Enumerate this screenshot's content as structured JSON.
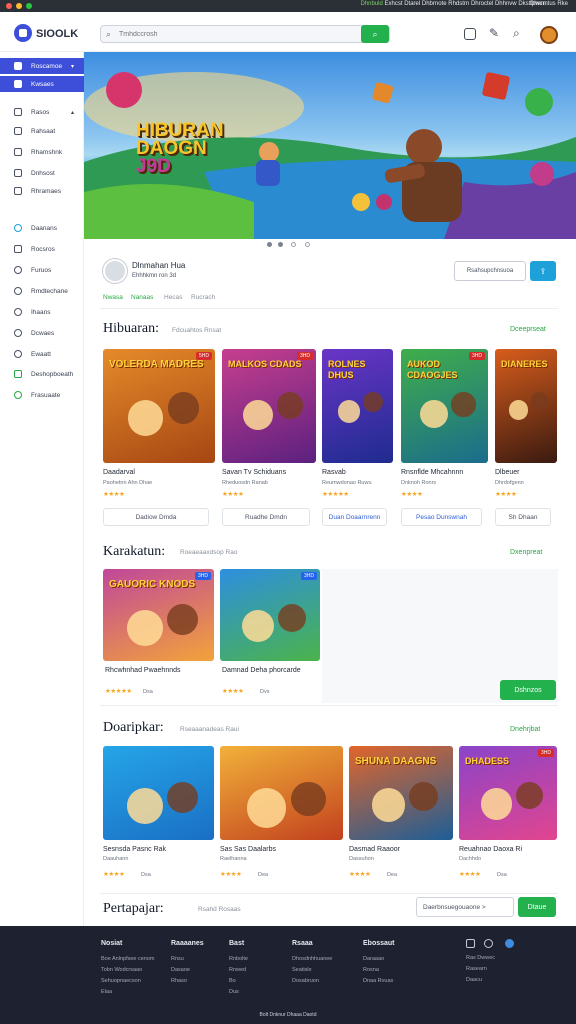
{
  "os": {
    "links": [
      "Dhnbuld",
      "Exhcst",
      "Dtarel",
      "Dhbrnote",
      "Rhdstrn",
      "Dhroctel",
      "Dhhnvw",
      "Dkstfpwcn"
    ],
    "user": "Dhenntus Rke"
  },
  "header": {
    "brand": "SIOOLK",
    "search_placeholder": "Tmhdccrosh",
    "search_button_icon": "search-icon",
    "icons": [
      "cast-icon",
      "edit-icon",
      "search-icon",
      "avatar"
    ]
  },
  "sidebar": {
    "items": [
      {
        "label": "Roscamoe",
        "active": true,
        "chevron": true
      },
      {
        "label": "Kwsaes",
        "active": true
      },
      {
        "label": "Rasos",
        "chevron": true
      },
      {
        "label": "Rahsaat"
      },
      {
        "label": "Rhamshnk"
      },
      {
        "label": "Dnhsost"
      },
      {
        "label": "Rhramaes"
      },
      {
        "label": "Daanans"
      },
      {
        "label": "Rocsros"
      },
      {
        "label": "Furuos"
      },
      {
        "label": "Rmdtechane"
      },
      {
        "label": "Ihaans"
      },
      {
        "label": "Dcwaes"
      },
      {
        "label": "Ewaatt"
      },
      {
        "label": "Deshopboeath"
      },
      {
        "label": "Frasuaate"
      }
    ]
  },
  "banner": {
    "title_line1": "HIBURAN",
    "title_line2": "DAOGN",
    "title_line3": "J9D",
    "page_dots": 4,
    "active_dot": 1
  },
  "channel": {
    "name": "Dlnmahan Hua",
    "sub": "Ehhhkmn ron 3d",
    "tabs": [
      "Nwasa",
      "Nanaas",
      "Hecas",
      "Rucrach"
    ],
    "active_tab": 0,
    "subscribe_label": "Rsahsupchnsuoa",
    "share_icon": "share-icon"
  },
  "sections": {
    "hiburan": {
      "title": "Hibuaran:",
      "subtitle": "Fdcuahtos Rnsat",
      "see_all": "Dceeprseat",
      "cards": [
        {
          "title": "Daadarval",
          "meta": "Paohetnn Ahn Dhae",
          "stars": "★★★★",
          "btn": "Dadiow Dmda",
          "badge": "5HD",
          "thumb_title": "VOLERDA MADRES",
          "colors": [
            "#e58b2a",
            "#a64613"
          ]
        },
        {
          "title": "Savan Tv Schiduans",
          "meta": "Rheduosdn Ranab",
          "stars": "★★★★",
          "btn": "Ruadhe Dmdn",
          "badge": "3HD",
          "thumb_title": "MALKOS CDADS",
          "colors": [
            "#c63f8e",
            "#5c2080"
          ]
        },
        {
          "title": "Rasvab",
          "meta": "Reumwdonao Ruwu",
          "stars": "★★★★★",
          "btn": "Duan Doaarnrenn",
          "badge": "",
          "thumb_title": "ROLNES DHUS",
          "colors": [
            "#6a35c7",
            "#1e2b8f"
          ]
        },
        {
          "title": "Rnsnflde Mhcahnnn",
          "meta": "Dnknoh Ronrs",
          "stars": "★★★★",
          "btn": "Pesao Dunswnah",
          "badge": "3HD",
          "thumb_title": "AUKOD CDAOGJES",
          "colors": [
            "#3fae4a",
            "#1b6c8c"
          ]
        },
        {
          "title": "Dlbeuer",
          "meta": "Dhrdofgenn",
          "stars": "★★★★",
          "btn": "Sh Dhaan",
          "badge": "",
          "thumb_title": "DIANERES",
          "colors": [
            "#d75d1c",
            "#3a1a10"
          ]
        }
      ]
    },
    "karakatun": {
      "title": "Karakatun:",
      "subtitle": "Roeaeaaxdsop Rao",
      "see_all": "Dxenpreat",
      "cards": [
        {
          "title": "Rhcwhnhad Pwaehnnds",
          "stars": "★★★★★",
          "rating": "Dsa",
          "badge": "3HD",
          "thumb_title": "GAUORIC KNODS",
          "colors": [
            "#c0479a",
            "#f2a33a"
          ]
        },
        {
          "title": "Damnad Deha phorcarde",
          "stars": "★★★★",
          "rating": "Dvs",
          "badge": "3HD",
          "thumb_title": "",
          "colors": [
            "#2d8fe0",
            "#4bb34a"
          ]
        }
      ],
      "action_label": "Dshnzos"
    },
    "doarikpkar": {
      "title": "Doaripkar:",
      "subtitle": "Rseaaanadeas Raui",
      "see_all": "Dnehrjbat",
      "cards": [
        {
          "title": "Sesnsda Pasnc Rak",
          "meta": "Daauhann",
          "stars": "★★★★",
          "rating": "Dsa",
          "badge": "",
          "thumb_title": "",
          "colors": [
            "#25a5e8",
            "#1a6fc4"
          ]
        },
        {
          "title": "Sas Sas Daalarbs",
          "meta": "Raelhanna",
          "stars": "★★★★",
          "rating": "Dea",
          "badge": "",
          "thumb_title": "",
          "colors": [
            "#f2b13a",
            "#c2411e"
          ]
        },
        {
          "title": "Dasmad Raaoor",
          "meta": "Dassuhon",
          "stars": "★★★★",
          "rating": "Dea",
          "badge": "",
          "thumb_title": "SHUNA DAAGNS",
          "colors": [
            "#e2652a",
            "#1d5e97"
          ]
        },
        {
          "title": "Reuahnao Daoxa Ri",
          "meta": "Dachhdo",
          "stars": "★★★★",
          "rating": "Dsa",
          "badge": "3HD",
          "thumb_title": "DHADESS",
          "colors": [
            "#8a44c9",
            "#e2458f"
          ]
        }
      ]
    },
    "pertapajar": {
      "title": "Pertapajar:",
      "subtitle": "Rsahd Rosaas",
      "input_label": "Daerbnsuegouaone >",
      "button_label": "Dtaue"
    }
  },
  "footer": {
    "columns": [
      {
        "heading": "Nosiat",
        "links": [
          "Boe Anlnpfsee cenom",
          "Tobn Wodcrsaao",
          "Sehuopnaecson",
          "Elaa"
        ]
      },
      {
        "heading": "Raaaanes",
        "links": [
          "Rnsu",
          "Dasaoe",
          "Rhaso"
        ]
      },
      {
        "heading": "Bast",
        "links": [
          "Rnbolte",
          "Rnwed",
          "Bo",
          "Dus"
        ]
      },
      {
        "heading": "Rsaaa",
        "links": [
          "Dhosdnhhuanee",
          "Seatisle",
          "Dosabruon"
        ]
      },
      {
        "heading": "Ebossaut",
        "links": [
          "Daraaao",
          "Rosna",
          "Dnaa Rvuas"
        ]
      },
      {
        "heading": "",
        "links": [
          "Ras Dwwec",
          "Rasearn",
          "Daacu"
        ]
      }
    ],
    "copyright": "Bolt Dnknur Dhaaa Daotd"
  }
}
